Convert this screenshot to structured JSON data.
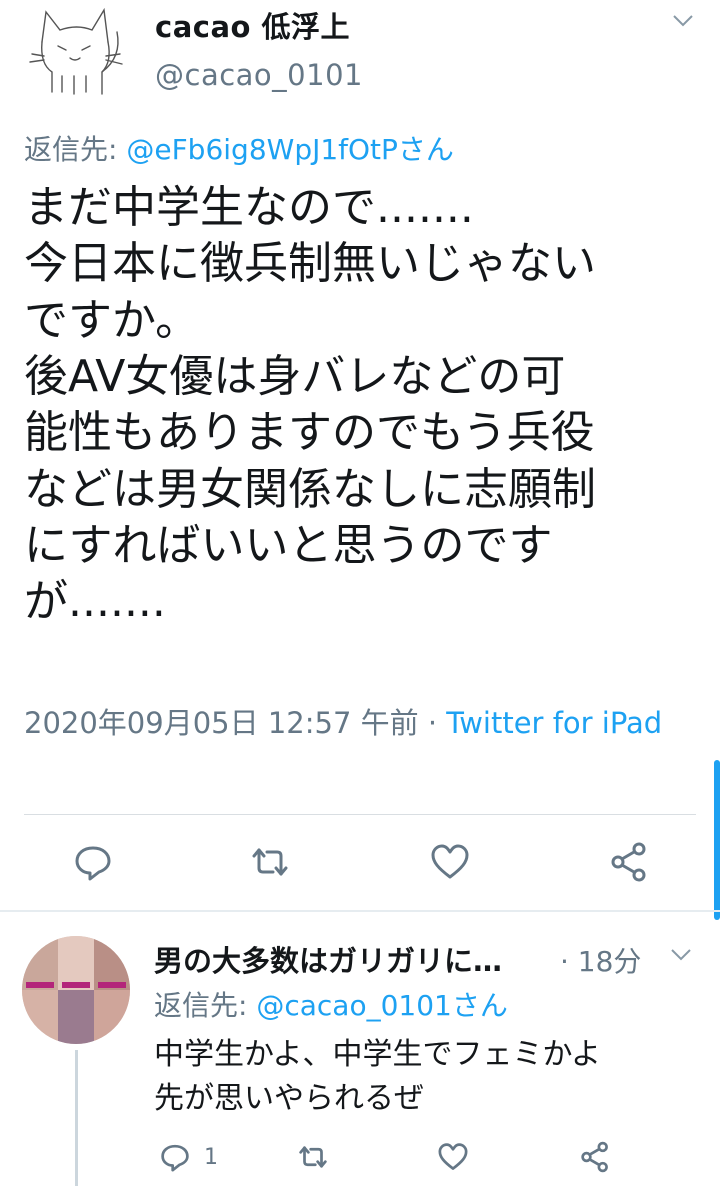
{
  "tweet": {
    "display_name": "cacao 低浮上",
    "handle": "@cacao_0101",
    "reply_prefix": "返信先: ",
    "reply_target": "@eFb6ig8WpJ1fOtPさん",
    "text": "まだ中学生なので.......\n今日本に徴兵制無いじゃない\nですか。\n後AV女優は身バレなどの可\n能性もありますのでもう兵役\nなどは男女関係なしに志願制\nにすればいいと思うのです\nが.......",
    "timestamp": "2020年09月05日 12:57 午前 · ",
    "source": "Twitter for iPad",
    "actions": {
      "reply": "reply-icon",
      "retweet": "retweet-icon",
      "like": "heart-icon",
      "share": "share-icon"
    }
  },
  "reply": {
    "display_name": "男の大多数はガリガリに…",
    "time": "· 18分",
    "reply_prefix": "返信先: ",
    "reply_target": "@cacao_0101さん",
    "text": "中学生かよ、中学生でフェミかよ\n先が思いやられるぜ",
    "reply_count": "1"
  },
  "colors": {
    "link": "#1da1f2",
    "secondary": "#657786",
    "text": "#14171a",
    "divider": "#e6ecf0"
  }
}
